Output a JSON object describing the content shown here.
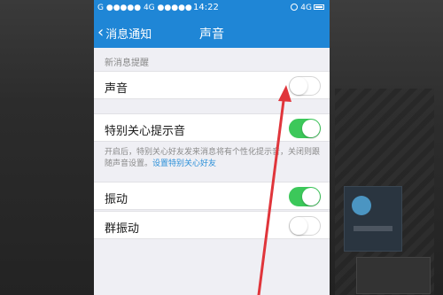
{
  "status_bar": {
    "left": "G ●●●●● 4G ●●●●●",
    "time": "14:22",
    "network": "4G"
  },
  "nav": {
    "back_label": "消息通知",
    "title": "声音"
  },
  "section_new_message": {
    "caption": "新消息提醒",
    "sound": {
      "label": "声音",
      "enabled": false
    }
  },
  "special_care": {
    "label": "特别关心提示音",
    "enabled": true,
    "description": "开启后，特别关心好友发来消息将有个性化提示音，关闭则跟随声音设置。",
    "link": "设置特别关心好友"
  },
  "vibration": {
    "label": "振动",
    "enabled": true
  },
  "group_vibration": {
    "label": "群振动",
    "enabled": false
  },
  "colors": {
    "header_blue": "#1f86d6",
    "toggle_on": "#3cc85a",
    "link": "#2a8fd8",
    "annotation_arrow": "#e0353b"
  },
  "icons": {
    "back": "chevron-left-icon",
    "alarm": "alarm-clock-icon",
    "battery": "battery-icon"
  }
}
